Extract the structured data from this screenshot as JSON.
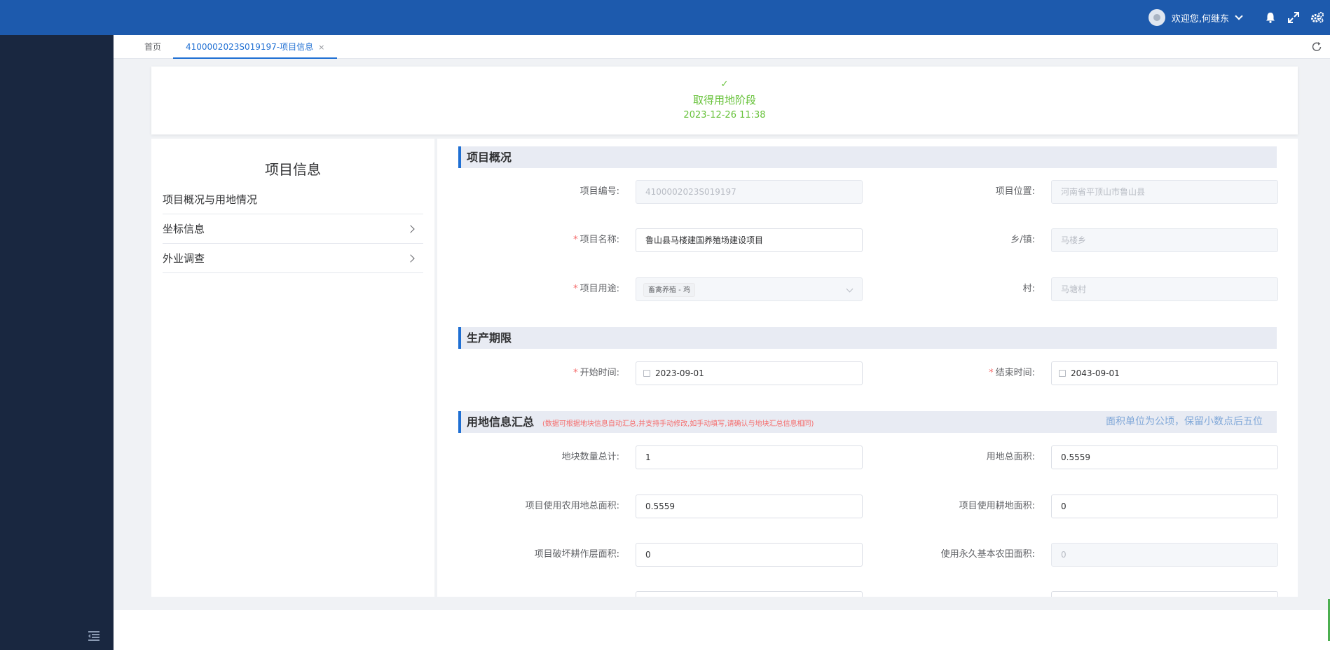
{
  "header": {
    "welcome": "欢迎您,何继东"
  },
  "tabs": [
    {
      "label": "首页"
    },
    {
      "label": "4100002023S019197-项目信息",
      "close": "×"
    }
  ],
  "stage": {
    "check": "✓",
    "name": "取得用地阶段",
    "time": "2023-12-26 11:38"
  },
  "left_panel": {
    "title": "项目信息",
    "menu": [
      {
        "label": "项目概况与用地情况"
      },
      {
        "label": "坐标信息"
      },
      {
        "label": "外业调查"
      }
    ]
  },
  "sections": {
    "overview": {
      "title": "项目概况",
      "project_no_label": "项目编号:",
      "project_no": "4100002023S019197",
      "location_label": "项目位置:",
      "location": "河南省平顶山市鲁山县",
      "name_label": "项目名称:",
      "name": "鲁山县马楼建国养殖场建设项目",
      "town_label": "乡/镇:",
      "town": "马楼乡",
      "usage_label": "项目用途:",
      "usage_tag": "畜禽养殖 - 鸡",
      "village_label": "村:",
      "village": "马塘村"
    },
    "period": {
      "title": "生产期限",
      "start_label": "开始时间:",
      "start": "2023-09-01",
      "end_label": "结束时间:",
      "end": "2043-09-01"
    },
    "land": {
      "title": "用地信息汇总",
      "note": "(数据可根据地块信息自动汇总,并支持手动修改,如手动填写,请确认与地块汇总信息相同)",
      "unit_hint": "面积单位为公顷，保留小数点后五位",
      "plot_count_label": "地块数量总计:",
      "plot_count": "1",
      "total_area_label": "用地总面积:",
      "total_area": "0.5559",
      "farmland_total_label": "项目使用农用地总面积:",
      "farmland_total": "0.5559",
      "cultivated_label": "项目使用耕地面积:",
      "cultivated": "0",
      "damaged_label": "项目破坏耕作层面积:",
      "damaged": "0",
      "permanent_label": "使用永久基本农田面积:",
      "permanent": "0"
    }
  }
}
